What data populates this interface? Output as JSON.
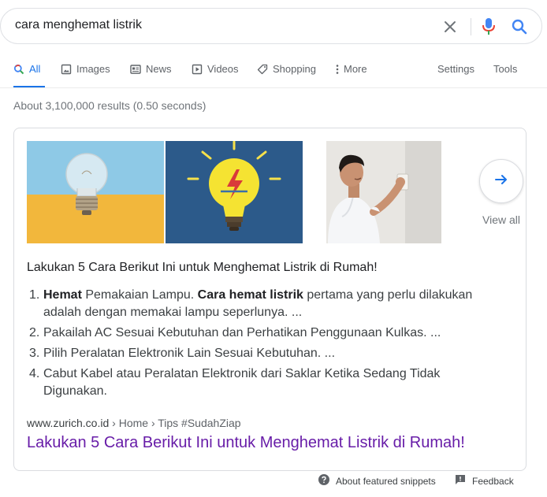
{
  "search": {
    "query": "cara menghemat listrik"
  },
  "tabs": [
    {
      "label": "All",
      "icon": "search-icon"
    },
    {
      "label": "Images",
      "icon": "image-icon"
    },
    {
      "label": "News",
      "icon": "news-icon"
    },
    {
      "label": "Videos",
      "icon": "play-icon"
    },
    {
      "label": "Shopping",
      "icon": "tag-icon"
    },
    {
      "label": "More",
      "icon": "more-vert-icon"
    },
    {
      "label": "Settings"
    },
    {
      "label": "Tools"
    }
  ],
  "result_stats": "About 3,100,000 results (0.50 seconds)",
  "snippet": {
    "view_all": "View all",
    "heading": "Lakukan 5 Cara Berikut Ini untuk Menghemat Listrik di Rumah!",
    "items": [
      {
        "number": "1.",
        "bold1": "Hemat",
        "text1": " Pemakaian Lampu. ",
        "bold2": "Cara hemat listrik",
        "text2": " pertama yang perlu dilakukan adalah dengan memakai lampu seperlunya. ..."
      },
      {
        "number": "2.",
        "text": "Pakailah AC Sesuai Kebutuhan dan Perhatikan Penggunaan Kulkas. ..."
      },
      {
        "number": "3.",
        "text": "Pilih Peralatan Elektronik Lain Sesuai Kebutuhan. ..."
      },
      {
        "number": "4.",
        "text": "Cabut Kabel atau Peralatan Elektronik dari Saklar Ketika Sedang Tidak Digunakan."
      }
    ],
    "breadcrumb_domain": "www.zurich.co.id",
    "breadcrumb_path": " › Home › Tips #SudahZiap",
    "title": "Lakukan 5 Cara Berikut Ini untuk Menghemat Listrik di Rumah!"
  },
  "footer": {
    "about": "About featured snippets",
    "feedback": "Feedback"
  },
  "colors": {
    "accent_blue": "#1a73e8",
    "visited_link": "#681da8",
    "mic_red": "#ea4335",
    "mic_yellow": "#fbbc04",
    "mic_green": "#34a853"
  }
}
